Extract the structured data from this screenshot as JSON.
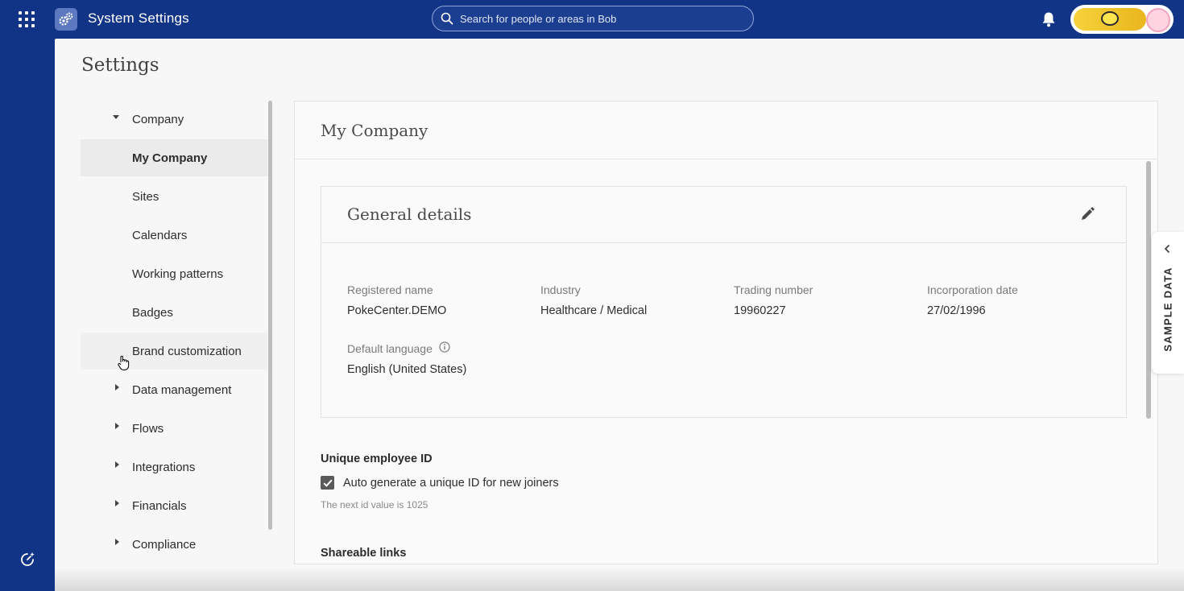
{
  "topbar": {
    "app_title": "System Settings",
    "search_placeholder": "Search for people or areas in Bob",
    "apps_icon": "grid-icon",
    "logo_icon": "settings-gears-icon",
    "notification_icon": "bell-icon"
  },
  "page": {
    "title": "Settings"
  },
  "nav": {
    "items": [
      {
        "label": "Company",
        "type": "section",
        "expanded": true
      },
      {
        "label": "My Company",
        "type": "child",
        "active": true
      },
      {
        "label": "Sites",
        "type": "child"
      },
      {
        "label": "Calendars",
        "type": "child"
      },
      {
        "label": "Working patterns",
        "type": "child"
      },
      {
        "label": "Badges",
        "type": "child"
      },
      {
        "label": "Brand customization",
        "type": "child",
        "hover": true
      },
      {
        "label": "Data management",
        "type": "section",
        "expanded": false
      },
      {
        "label": "Flows",
        "type": "section",
        "expanded": false
      },
      {
        "label": "Integrations",
        "type": "section",
        "expanded": false
      },
      {
        "label": "Financials",
        "type": "section",
        "expanded": false
      },
      {
        "label": "Compliance",
        "type": "section",
        "expanded": false
      }
    ]
  },
  "card": {
    "title": "My Company",
    "general": {
      "title": "General details",
      "fields": [
        {
          "label": "Registered name",
          "value": "PokeCenter.DEMO"
        },
        {
          "label": "Industry",
          "value": "Healthcare / Medical"
        },
        {
          "label": "Trading number",
          "value": "19960227"
        },
        {
          "label": "Incorporation date",
          "value": "27/02/1996"
        },
        {
          "label": "Default language",
          "value": "English (United States)"
        }
      ]
    },
    "unique_id": {
      "title": "Unique employee ID",
      "checkbox_label": "Auto generate a unique ID for new joiners",
      "checked": true,
      "hint": "The next id value is 1025"
    },
    "shareable_links": {
      "title": "Shareable links"
    }
  },
  "sample_data_tab": {
    "label": "SAMPLE DATA"
  },
  "colors": {
    "topbar": "#123487",
    "page_bg": "#f7f7f7",
    "active_nav": "#ebebeb"
  }
}
